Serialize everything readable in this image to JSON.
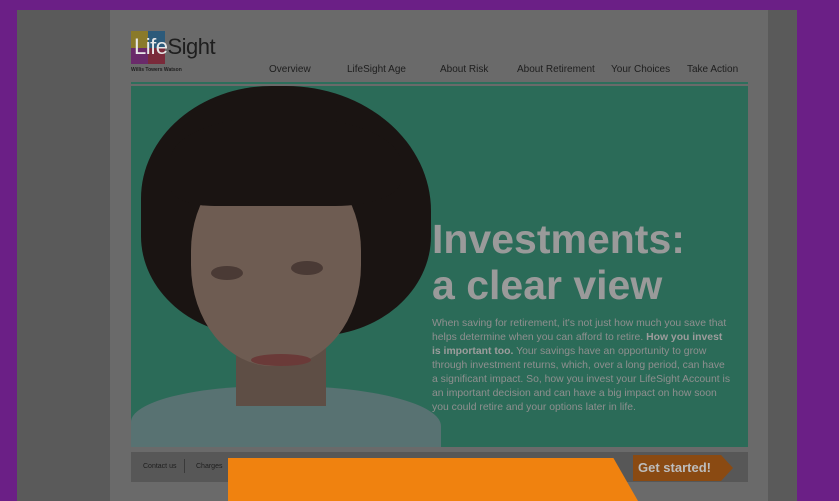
{
  "brand": {
    "name_part1": "Life",
    "name_part2": "Sight",
    "sub": "Willis Towers Watson"
  },
  "nav": {
    "items": [
      "Overview",
      "LifeSight Age",
      "About Risk",
      "About Retirement",
      "Your Choices",
      "Take Action"
    ]
  },
  "hero": {
    "headline_line1": "Investments:",
    "headline_line2": "a clear view",
    "body_part1": "When saving for retirement, it's not just how much you save that helps determine when you can afford to retire.",
    "body_bold": "How you invest is important too.",
    "body_part2": "Your savings have an opportunity to grow through investment returns, which, over a long period, can have a significant impact. So, how you invest your LifeSight Account is an important decision and can have a big impact on how soon you could retire and your options later in life."
  },
  "footer": {
    "contact_label": "Contact us",
    "charges_label": "Charges"
  },
  "cta": {
    "label": "Get started!"
  },
  "colors": {
    "background": "#6b1f86",
    "hero": "#2b6b58",
    "cta": "#8a4a12",
    "overlay_orange": "#f0820f"
  }
}
